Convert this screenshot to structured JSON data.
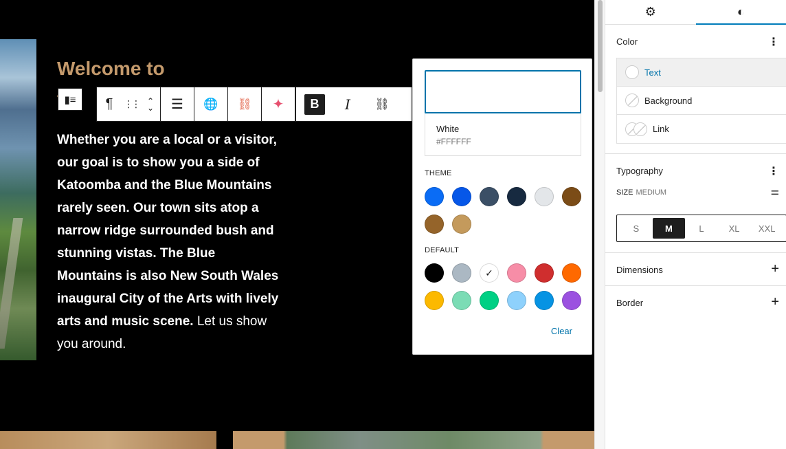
{
  "canvas": {
    "heading_line1": "Welcome to",
    "heading_line2_fragment": "to",
    "body_segments": [
      {
        "text": "Whether you are a local or a visitor, our goal is to show you a side of Katoomba and the Blue Mountains rarely seen.  Our town sits atop a narrow ridge surrounded bush and stunning vistas.  The Blue Mountains is also New South Wales inaugural City of the Arts with lively arts and music scene.",
        "bold": true
      },
      {
        "text": " Let us show you around.",
        "bold": false
      }
    ]
  },
  "toolbar": {
    "block_icon": "▮≡",
    "paragraph": "¶",
    "drag": "⋮⋮",
    "move_up": "⌃",
    "move_down": "⌄",
    "align": "☰",
    "language": "🌐",
    "link_orange": "⛓",
    "sparkle": "✦",
    "bold": "B",
    "italic": "I",
    "link": "⛓"
  },
  "color_popover": {
    "selected_name": "White",
    "selected_hex": "#FFFFFF",
    "theme_label": "THEME",
    "theme_colors": [
      "#0a6cf5",
      "#0657e8",
      "#3b4f66",
      "#172a40",
      "#e3e6e9",
      "#7b4c17",
      "#95642a",
      "#c49a5c"
    ],
    "default_label": "DEFAULT",
    "default_colors": [
      "#000000",
      "#abb8c3",
      "#ffffff",
      "#f78da7",
      "#cf2e2e",
      "#ff6900",
      "#fcb900",
      "#7bdcb5",
      "#00d084",
      "#8ed1fc",
      "#0693e3",
      "#9b51e0"
    ],
    "checked_color": "#ffffff",
    "checkmark": "✓",
    "clear_label": "Clear"
  },
  "sidebar": {
    "tabs": [
      {
        "icon": "⚙",
        "name": "settings"
      },
      {
        "icon": "◐",
        "name": "styles"
      }
    ],
    "color_title": "Color",
    "menu_icon": "⋮",
    "color_items": [
      {
        "label": "Text",
        "selected": true
      },
      {
        "label": "Background",
        "selected": false
      },
      {
        "label": "Link",
        "selected": false
      }
    ],
    "typography_title": "Typography",
    "size_label": "SIZE",
    "size_value": "MEDIUM",
    "size_icon": "⚌",
    "sizes": [
      "S",
      "M",
      "L",
      "XL",
      "XXL"
    ],
    "active_size": "M",
    "dimensions_title": "Dimensions",
    "border_title": "Border",
    "plus": "+"
  }
}
